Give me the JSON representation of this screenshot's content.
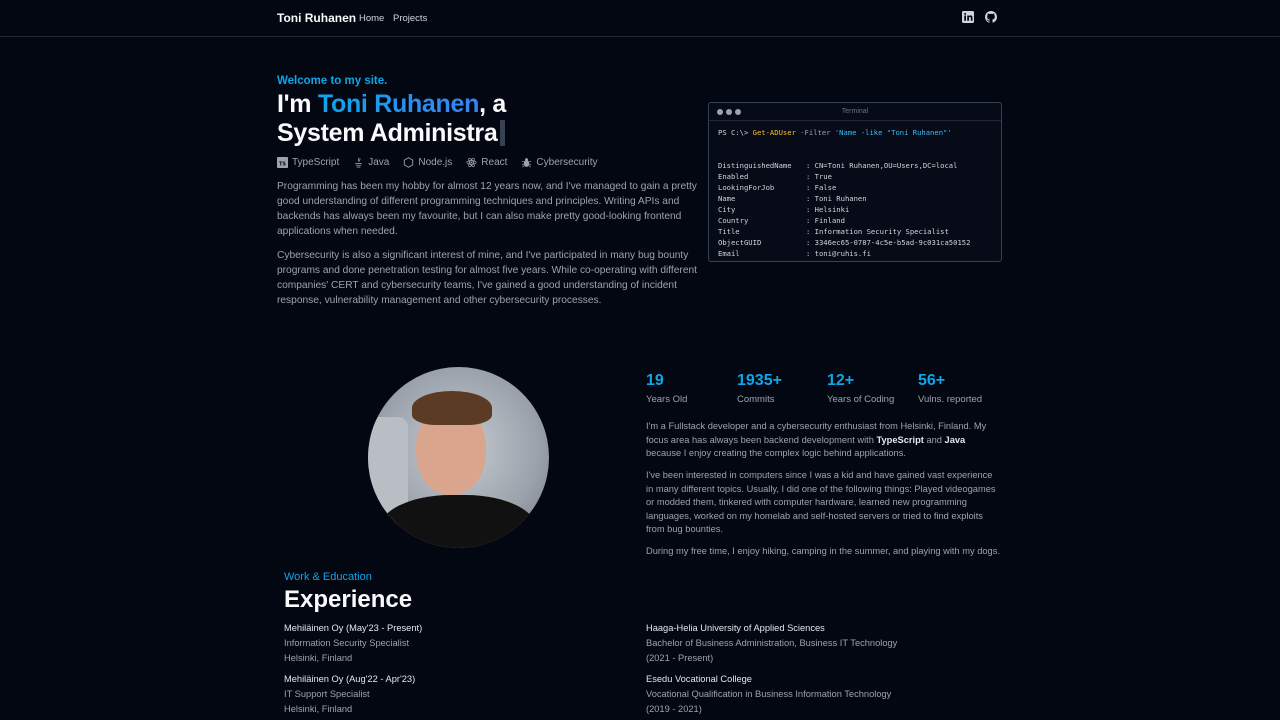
{
  "nav": {
    "brand": "Toni Ruhanen",
    "links": [
      "Home",
      "Projects"
    ],
    "icons": [
      "linkedin-icon",
      "github-icon"
    ]
  },
  "hero": {
    "welcome": "Welcome to my site.",
    "title_prefix": "I'm ",
    "title_name": "Toni Ruhanen",
    "title_suffix": ", a",
    "typed_role": "System Administra",
    "skills": [
      "TypeScript",
      "Java",
      "Node.js",
      "React",
      "Cybersecurity"
    ],
    "paragraphs": [
      "Programming has been my hobby for almost 12 years now, and I've managed to gain a pretty good understanding of different programming techniques and principles. Writing APIs and backends has always been my favourite, but I can also make pretty good-looking frontend applications when needed.",
      "Cybersecurity is also a significant interest of mine, and I've participated in many bug bounty programs and done penetration testing for almost five years. While co-operating with different companies' CERT and cybersecurity teams, I've gained a good understanding of incident response, vulnerability management and other cybersecurity processes."
    ]
  },
  "terminal": {
    "title": "Terminal",
    "prompt": "PS C:\\> ",
    "command": "Get-ADUser",
    "flag": " -Filter ",
    "filter": "'Name -like \"Toni Ruhanen\"'",
    "rows": [
      {
        "key": "DistinguishedName",
        "value": ": CN=Toni Ruhanen,OU=Users,DC=local"
      },
      {
        "key": "Enabled",
        "value": ": True"
      },
      {
        "key": "LookingForJob",
        "value": ": False"
      },
      {
        "key": "Name",
        "value": ": Toni Ruhanen"
      },
      {
        "key": "City",
        "value": ": Helsinki"
      },
      {
        "key": "Country",
        "value": ": Finland"
      },
      {
        "key": "Title",
        "value": ": Information Security Specialist"
      },
      {
        "key": "ObjectGUID",
        "value": ": 3346ec65-0787-4c5e-b5ad-9c031ca50152"
      },
      {
        "key": "Email",
        "value": ": toni@ruhis.fi"
      }
    ]
  },
  "stats": [
    {
      "value": "19",
      "label": "Years Old"
    },
    {
      "value": "1935+",
      "label": "Commits"
    },
    {
      "value": "12+",
      "label": "Years of Coding"
    },
    {
      "value": "56+",
      "label": "Vulns. reported"
    }
  ],
  "about": {
    "p1_a": "I'm a Fullstack developer and a cybersecurity enthusiast from Helsinki, Finland. My focus area has always been backend development with ",
    "p1_b": "TypeScript",
    "p1_c": " and ",
    "p1_d": "Java",
    "p1_e": " because I enjoy creating the complex logic behind applications.",
    "p2": "I've been interested in computers since I was a kid and have gained vast experience in many different topics. Usually, I did one of the following things: Played videogames or modded them, tinkered with computer hardware, learned new programming languages, worked on my homelab and self-hosted servers or tried to find exploits from bug bounties.",
    "p3": "During my free time, I enjoy hiking, camping in the summer, and playing with my dogs."
  },
  "experience": {
    "label": "Work & Education",
    "title": "Experience",
    "work": [
      {
        "company": "Mehiläinen Oy (May'23 - Present)",
        "role": "Information Security Specialist",
        "location": "Helsinki, Finland"
      },
      {
        "company": "Mehiläinen Oy (Aug'22 - Apr'23)",
        "role": "IT Support Specialist",
        "location": "Helsinki, Finland"
      }
    ],
    "education": [
      {
        "school": "Haaga-Helia University of Applied Sciences",
        "degree": "Bachelor of Business Administration, Business IT Technology",
        "years": "(2021 - Present)"
      },
      {
        "school": "Esedu Vocational College",
        "degree": "Vocational Qualification in Business Information Technology",
        "years": "(2019 - 2021)"
      }
    ]
  }
}
